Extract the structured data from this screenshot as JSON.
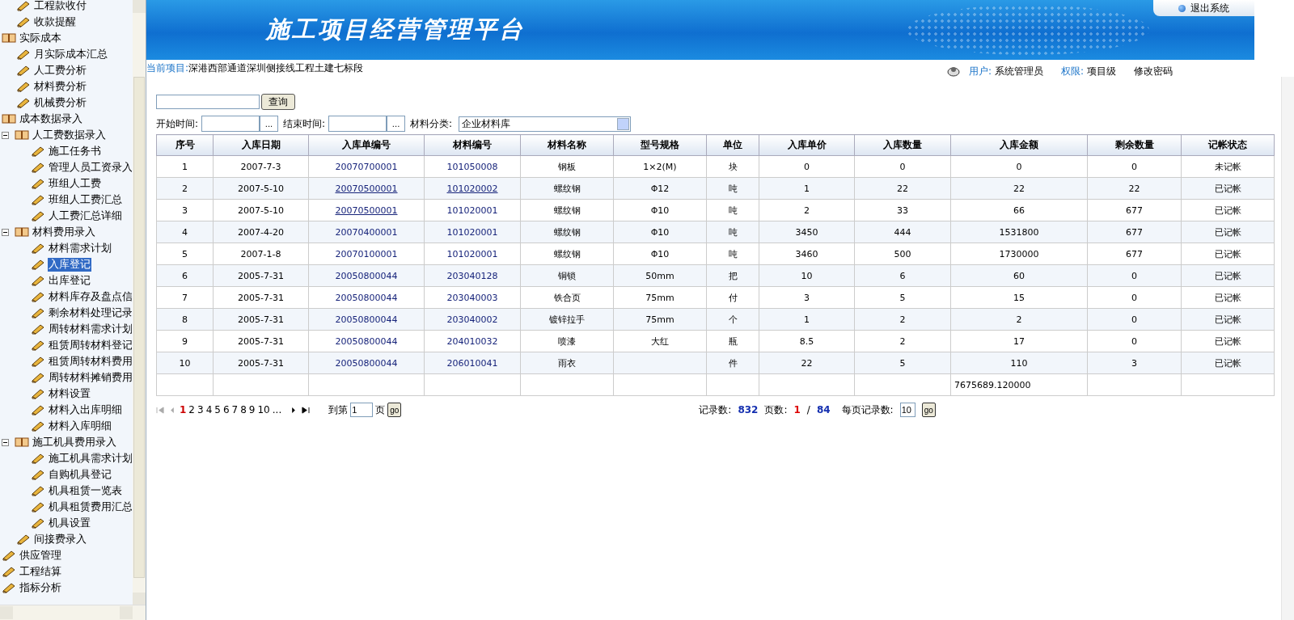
{
  "sidebar": {
    "items": [
      {
        "kind": "continuation",
        "children": [
          {
            "kind": "leaf",
            "label": "工程款收付",
            "selected": false
          },
          {
            "kind": "leaf",
            "label": "收款提醒",
            "selected": false
          }
        ]
      },
      {
        "kind": "folder",
        "label": "实际成本",
        "selected": false,
        "children": [
          {
            "kind": "leaf",
            "label": "月实际成本汇总",
            "selected": false
          },
          {
            "kind": "leaf",
            "label": "人工费分析",
            "selected": false
          },
          {
            "kind": "leaf",
            "label": "材料费分析",
            "selected": false
          },
          {
            "kind": "leaf",
            "label": "机械费分析",
            "selected": false
          }
        ]
      },
      {
        "kind": "folder",
        "label": "成本数据录入",
        "selected": false,
        "children": [
          {
            "kind": "folder",
            "label": "人工费数据录入",
            "selected": false,
            "expanded": true,
            "children": [
              {
                "kind": "leaf",
                "label": "施工任务书",
                "selected": false
              },
              {
                "kind": "leaf",
                "label": "管理人员工资录入",
                "selected": false
              },
              {
                "kind": "leaf",
                "label": "班组人工费",
                "selected": false
              },
              {
                "kind": "leaf",
                "label": "班组人工费汇总",
                "selected": false
              },
              {
                "kind": "leaf",
                "label": "人工费汇总详细",
                "selected": false
              }
            ]
          },
          {
            "kind": "folder",
            "label": "材料费用录入",
            "selected": false,
            "expanded": true,
            "children": [
              {
                "kind": "leaf",
                "label": "材料需求计划",
                "selected": false
              },
              {
                "kind": "leaf",
                "label": "入库登记",
                "selected": true
              },
              {
                "kind": "leaf",
                "label": "出库登记",
                "selected": false
              },
              {
                "kind": "leaf",
                "label": "材料库存及盘点信",
                "selected": false
              },
              {
                "kind": "leaf",
                "label": "剩余材料处理记录",
                "selected": false
              },
              {
                "kind": "leaf",
                "label": "周转材料需求计划",
                "selected": false
              },
              {
                "kind": "leaf",
                "label": "租赁周转材料登记",
                "selected": false
              },
              {
                "kind": "leaf",
                "label": "租赁周转材料费用",
                "selected": false
              },
              {
                "kind": "leaf",
                "label": "周转材料摊销费用",
                "selected": false
              },
              {
                "kind": "leaf",
                "label": "材料设置",
                "selected": false
              },
              {
                "kind": "leaf",
                "label": "材料入出库明细",
                "selected": false
              },
              {
                "kind": "leaf",
                "label": "材料入库明细",
                "selected": false
              }
            ]
          },
          {
            "kind": "folder",
            "label": "施工机具费用录入",
            "selected": false,
            "expanded": true,
            "children": [
              {
                "kind": "leaf",
                "label": "施工机具需求计划",
                "selected": false
              },
              {
                "kind": "leaf",
                "label": "自购机具登记",
                "selected": false
              },
              {
                "kind": "leaf",
                "label": "机具租赁一览表",
                "selected": false
              },
              {
                "kind": "leaf",
                "label": "机具租赁费用汇总",
                "selected": false
              },
              {
                "kind": "leaf",
                "label": "机具设置",
                "selected": false
              }
            ]
          },
          {
            "kind": "leaf",
            "label": "间接费录入",
            "selected": false
          }
        ]
      },
      {
        "kind": "leaf",
        "label": "供应管理",
        "selected": false
      },
      {
        "kind": "leaf",
        "label": "工程结算",
        "selected": false
      },
      {
        "kind": "leaf",
        "label": "指标分析",
        "selected": false
      }
    ]
  },
  "header": {
    "title": "施工项目经营管理平台",
    "logout": "退出系统"
  },
  "project": {
    "label": "当前项目:",
    "name": "深港西部通道深圳侧接线工程土建七标段"
  },
  "user": {
    "user_label": "用户:",
    "user_name": "系统管理员",
    "role_label": "权限:",
    "role": "项目级",
    "change_password": "修改密码"
  },
  "search": {
    "button": "查询"
  },
  "filters": {
    "start_label": "开始时间:",
    "end_label": "结束时间:",
    "picker": "...",
    "end_picker": "...",
    "category_label": "材料分类:",
    "category": "企业材料库"
  },
  "table": {
    "columns": [
      "序号",
      "入库日期",
      "入库单编号",
      "材料编号",
      "材料名称",
      "型号规格",
      "单位",
      "入库单价",
      "入库数量",
      "入库金额",
      "剩余数量",
      "记帐状态"
    ],
    "rows": [
      {
        "no": "1",
        "date": "2007-7-3",
        "order_no": "20070700001",
        "order_underlined": false,
        "material_no": "101050008",
        "material_underlined": false,
        "name": "钢板",
        "spec": "1×2(M)",
        "unit": "块",
        "price": "0",
        "qty": "0",
        "amount": "0",
        "remaining": "0",
        "status": "未记帐"
      },
      {
        "no": "2",
        "date": "2007-5-10",
        "order_no": "20070500001",
        "order_underlined": true,
        "material_no": "101020002",
        "material_underlined": true,
        "name": "螺纹钢",
        "spec": "Φ12",
        "unit": "吨",
        "price": "1",
        "qty": "22",
        "amount": "22",
        "remaining": "22",
        "status": "已记帐"
      },
      {
        "no": "3",
        "date": "2007-5-10",
        "order_no": "20070500001",
        "order_underlined": true,
        "material_no": "101020001",
        "material_underlined": false,
        "name": "螺纹钢",
        "spec": "Φ10",
        "unit": "吨",
        "price": "2",
        "qty": "33",
        "amount": "66",
        "remaining": "677",
        "status": "已记帐"
      },
      {
        "no": "4",
        "date": "2007-4-20",
        "order_no": "20070400001",
        "order_underlined": false,
        "material_no": "101020001",
        "material_underlined": false,
        "name": "螺纹钢",
        "spec": "Φ10",
        "unit": "吨",
        "price": "3450",
        "qty": "444",
        "amount": "1531800",
        "remaining": "677",
        "status": "已记帐"
      },
      {
        "no": "5",
        "date": "2007-1-8",
        "order_no": "20070100001",
        "order_underlined": false,
        "material_no": "101020001",
        "material_underlined": false,
        "name": "螺纹钢",
        "spec": "Φ10",
        "unit": "吨",
        "price": "3460",
        "qty": "500",
        "amount": "1730000",
        "remaining": "677",
        "status": "已记帐"
      },
      {
        "no": "6",
        "date": "2005-7-31",
        "order_no": "20050800044",
        "order_underlined": false,
        "material_no": "203040128",
        "material_underlined": false,
        "name": "铜锁",
        "spec": "50mm",
        "unit": "把",
        "price": "10",
        "qty": "6",
        "amount": "60",
        "remaining": "0",
        "status": "已记帐"
      },
      {
        "no": "7",
        "date": "2005-7-31",
        "order_no": "20050800044",
        "order_underlined": false,
        "material_no": "203040003",
        "material_underlined": false,
        "name": "铁合页",
        "spec": "75mm",
        "unit": "付",
        "price": "3",
        "qty": "5",
        "amount": "15",
        "remaining": "0",
        "status": "已记帐"
      },
      {
        "no": "8",
        "date": "2005-7-31",
        "order_no": "20050800044",
        "order_underlined": false,
        "material_no": "203040002",
        "material_underlined": false,
        "name": "镀锌拉手",
        "spec": "75mm",
        "unit": "个",
        "price": "1",
        "qty": "2",
        "amount": "2",
        "remaining": "0",
        "status": "已记帐"
      },
      {
        "no": "9",
        "date": "2005-7-31",
        "order_no": "20050800044",
        "order_underlined": false,
        "material_no": "204010032",
        "material_underlined": false,
        "name": "喷漆",
        "spec": "大红",
        "unit": "瓶",
        "price": "8.5",
        "qty": "2",
        "amount": "17",
        "remaining": "0",
        "status": "已记帐"
      },
      {
        "no": "10",
        "date": "2005-7-31",
        "order_no": "20050800044",
        "order_underlined": false,
        "material_no": "206010041",
        "material_underlined": false,
        "name": "雨衣",
        "unit": "件",
        "price": "22",
        "qty": "5",
        "amount": "110",
        "remaining": "3",
        "status": "已记帐"
      }
    ],
    "total_amount": "7675689.120000"
  },
  "pager": {
    "pages": [
      {
        "label": "1",
        "selected": true
      },
      {
        "label": "2",
        "selected": false
      },
      {
        "label": "3",
        "selected": false
      },
      {
        "label": "4",
        "selected": false
      },
      {
        "label": "5",
        "selected": false
      },
      {
        "label": "6",
        "selected": false
      },
      {
        "label": "7",
        "selected": false
      },
      {
        "label": "8",
        "selected": false
      },
      {
        "label": "9",
        "selected": false
      },
      {
        "label": "10",
        "selected": false
      }
    ],
    "more": "...",
    "goto_label": "到第",
    "goto_value": "1",
    "goto_suffix": "页",
    "go": "go",
    "records_label": "记录数:",
    "records": "832",
    "pages_label": "页数:",
    "current_page": "1",
    "separator": "/",
    "total_pages": "84",
    "per_page_label": "每页记录数:",
    "per_page": "10",
    "per_page_go": "go"
  }
}
